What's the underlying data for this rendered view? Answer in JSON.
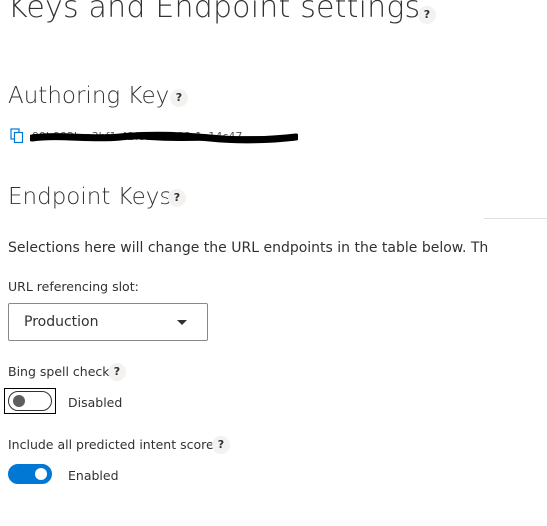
{
  "page": {
    "title": "Keys and Endpoint settings",
    "help": "?"
  },
  "authoring": {
    "heading": "Authoring Key",
    "help": "?",
    "key_value": "99b992b-a3bf1-42f8999-b92-1c14c47"
  },
  "endpoint": {
    "heading": "Endpoint Keys",
    "help": "?",
    "description": "Selections here will change the URL endpoints in the table below. The",
    "slot_label": "URL referencing slot:",
    "slot_value": "Production",
    "spell_check": {
      "label": "Bing spell check",
      "help": "?",
      "state": "Disabled",
      "on": false
    },
    "intent_scores": {
      "label": "Include all predicted intent scores",
      "help": "?",
      "state": "Enabled",
      "on": true
    }
  },
  "colors": {
    "accent": "#0078d4",
    "text": "#323130"
  },
  "icons": {
    "copy": "copy-icon",
    "caret": "chevron-down-icon"
  }
}
